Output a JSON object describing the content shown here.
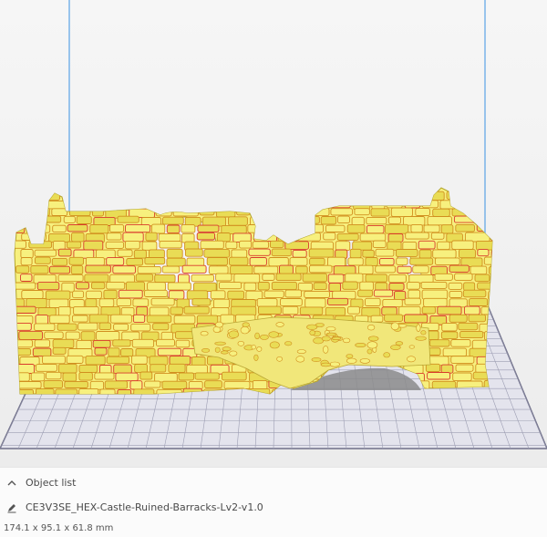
{
  "colors": {
    "model": "#f7f07e",
    "model_shade": "#e9dc55",
    "mortar": "#d18f1f",
    "overhang": "#d83a2c",
    "plate_fill": "#e4e4ed",
    "plate_grid": "#9c9db2",
    "plate_border": "#6f6f89",
    "build_volume_line": "#5aa3e6",
    "shadow": "#8b8b8b"
  },
  "object_list": {
    "toggle_icon": "chevron-up-icon",
    "title": "Object list",
    "edit_icon": "pencil-icon",
    "file_name": "CE3V3SE_HEX-Castle-Ruined-Barracks-Lv2-v1.0",
    "dimensions": "174.1 x 95.1 x 61.8 mm"
  }
}
